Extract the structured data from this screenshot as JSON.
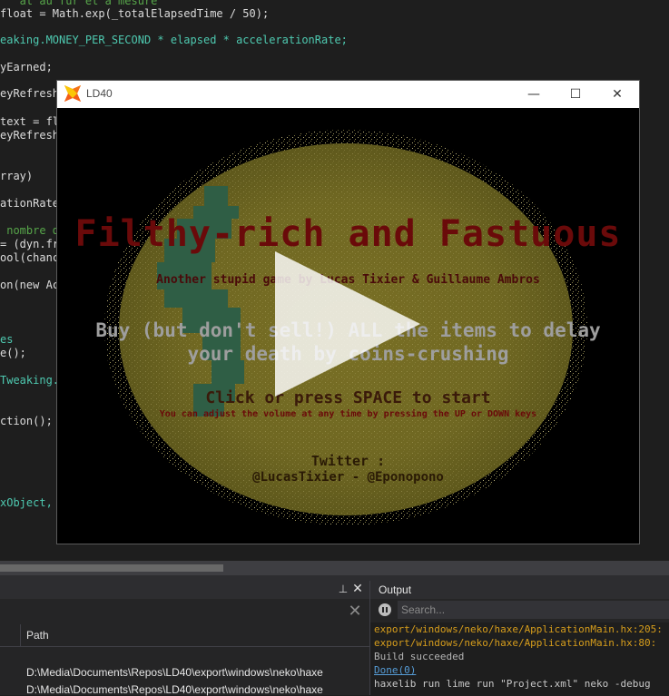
{
  "editor": {
    "lines": [
      {
        "text": "   at au fur et a mesure",
        "color": "#57a64a"
      },
      {
        "text": "float = Math.exp(_totalElapsedTime / 50);",
        "color": "#dcdcdc"
      },
      {
        "text": "eaking.MONEY_PER_SECOND * elapsed * accelerationRate;",
        "color": "#4ec9b0"
      },
      {
        "text": "yEarned;",
        "color": "#dcdcdc"
      },
      {
        "text": "eyRefresh",
        "color": "#dcdcdc"
      },
      {
        "text": "text = fl",
        "color": "#dcdcdc"
      },
      {
        "text": "eyRefresh",
        "color": "#dcdcdc"
      },
      {
        "text": "rray)",
        "color": "#dcdcdc"
      },
      {
        "text": "ationRate:",
        "color": "#dcdcdc"
      },
      {
        "text": " nombre d'",
        "color": "#57a64a"
      },
      {
        "text": "= (dyn.fre",
        "color": "#dcdcdc"
      },
      {
        "text": "ool(chance",
        "color": "#dcdcdc"
      },
      {
        "text": "on(new Ac",
        "color": "#dcdcdc"
      },
      {
        "text": "es",
        "color": "#4ec9b0"
      },
      {
        "text": "e();",
        "color": "#dcdcdc"
      },
      {
        "text": "Tweaking.F",
        "color": "#4ec9b0"
      },
      {
        "text": "ction();",
        "color": "#dcdcdc"
      },
      {
        "text": "xObject, g",
        "color": "#4ec9b0"
      }
    ]
  },
  "game_window": {
    "title": "LD40",
    "minimize": "—",
    "maximize": "☐",
    "close": "✕",
    "game_title": "Filthy-rich and Fastuous",
    "subtitle": "Another stupid game by Lucas Tixier & Guillaume Ambros",
    "instruction": "Buy (but don't sell!) ALL the items to delay\nyour death by coins-crushing",
    "start_prompt": "Click or press SPACE to start",
    "volume_hint": "You can adjust the volume at any time by pressing the UP or DOWN keys",
    "twitter_heading": "Twitter :",
    "twitter_handles": "@LucasTixier - @Eponopono",
    "colors": {
      "coin": "#e6d27a",
      "dollar": "#2f5e45",
      "title": "#6a0a0a"
    }
  },
  "find_results": {
    "pin": "⊥",
    "close": "✕",
    "clear": "✕",
    "column_path": "Path",
    "rows": [
      "D:\\Media\\Documents\\Repos\\LD40\\export\\windows\\neko\\haxe",
      "D:\\Media\\Documents\\Repos\\LD40\\export\\windows\\neko\\haxe"
    ]
  },
  "output": {
    "title": "Output",
    "search_placeholder": "Search...",
    "lines": [
      {
        "text": "export/windows/neko/haxe/ApplicationMain.hx:205:",
        "color": "#d69d1c"
      },
      {
        "text": "export/windows/neko/haxe/ApplicationMain.hx:80:",
        "color": "#d69d1c"
      },
      {
        "text": "Build succeeded",
        "color": "#b4b4b4"
      },
      {
        "text": "Done(0)",
        "color": "#569cd6"
      },
      {
        "text": "haxelib run lime run \"Project.xml\" neko -debug",
        "color": "#c8c8c8"
      }
    ]
  }
}
